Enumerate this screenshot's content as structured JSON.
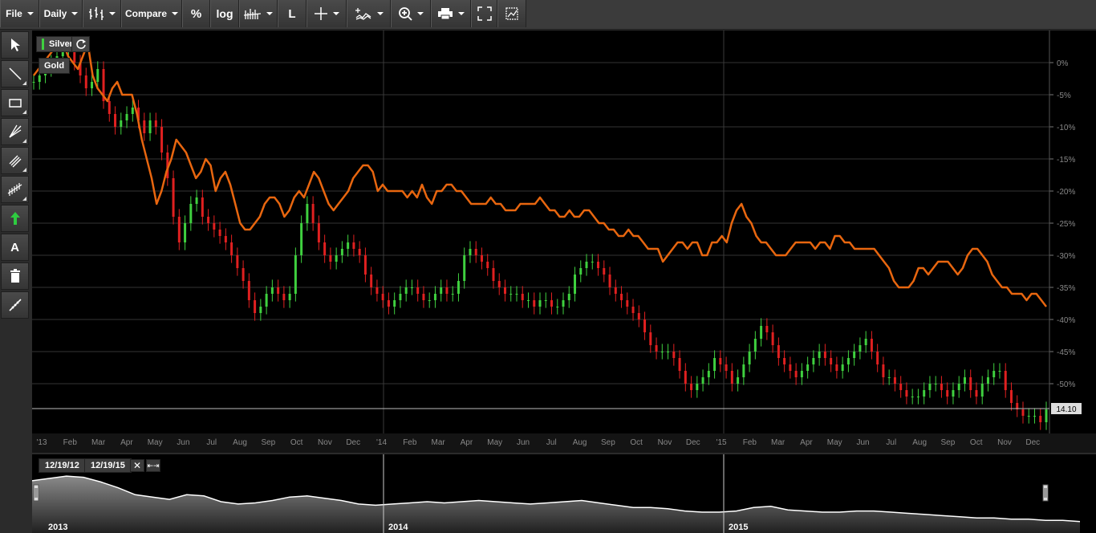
{
  "toolbar": {
    "file": "File",
    "period": "Daily",
    "compare": "Compare",
    "percent": "%",
    "log": "log",
    "line_tool": "L"
  },
  "legend": {
    "series1": "Silver",
    "series2": "Gold"
  },
  "side_tools": [
    {
      "name": "pointer-tool-button",
      "icon": "arrow-cursor-icon"
    },
    {
      "name": "line-tool-button",
      "icon": "diagonal-line-icon"
    },
    {
      "name": "rectangle-tool-button",
      "icon": "rectangle-icon"
    },
    {
      "name": "fan-tool-button",
      "icon": "fan-lines-icon"
    },
    {
      "name": "channel-tool-button",
      "icon": "parallel-lines-icon"
    },
    {
      "name": "pattern-tool-button",
      "icon": "zigzag-pattern-icon"
    },
    {
      "name": "arrow-marker-button",
      "icon": "green-up-arrow-icon"
    },
    {
      "name": "text-tool-button",
      "icon": "text-a-icon",
      "label": "A"
    },
    {
      "name": "delete-drawings-button",
      "icon": "trash-icon"
    },
    {
      "name": "ruler-tool-button",
      "icon": "ruler-icon"
    }
  ],
  "price_label": "14.10",
  "navigator": {
    "start_date": "12/19/12",
    "end_date": "12/19/15",
    "years": [
      "2013",
      "2014",
      "2015"
    ]
  },
  "colors": {
    "silver_up": "#3fd03f",
    "silver_down": "#e02020",
    "gold": "#e8660f",
    "background": "#000000",
    "grid": "#333333",
    "navigator_line": "#ffffff"
  },
  "chart_data": {
    "type": "line",
    "x_ticks": [
      "'13",
      "Feb",
      "Mar",
      "Apr",
      "May",
      "Jun",
      "Jul",
      "Aug",
      "Sep",
      "Oct",
      "Nov",
      "Dec",
      "'14",
      "Feb",
      "Mar",
      "Apr",
      "May",
      "Jun",
      "Jul",
      "Aug",
      "Sep",
      "Oct",
      "Nov",
      "Dec",
      "'15",
      "Feb",
      "Mar",
      "Apr",
      "May",
      "Jun",
      "Jul",
      "Aug",
      "Sep",
      "Oct",
      "Nov",
      "Dec"
    ],
    "y_ticks": [
      "0%",
      "-5%",
      "-10%",
      "-15%",
      "-20%",
      "-25%",
      "-30%",
      "-35%",
      "-40%",
      "-45%",
      "-50%"
    ],
    "ylim": [
      -57,
      4
    ],
    "series": [
      {
        "name": "Gold",
        "style": "line",
        "values": [
          -2,
          -1,
          0,
          1,
          2,
          3,
          3,
          1,
          0,
          -1,
          1,
          3,
          -2,
          -4,
          -5,
          -6,
          -4,
          -3,
          -5,
          -5,
          -5,
          -8,
          -12,
          -15,
          -18,
          -22,
          -20,
          -17,
          -15,
          -12,
          -13,
          -14,
          -16,
          -18,
          -17,
          -15,
          -16,
          -20,
          -18,
          -17,
          -19,
          -22,
          -25,
          -26,
          -26,
          -25,
          -24,
          -22,
          -21,
          -21,
          -22,
          -24,
          -23,
          -21,
          -20,
          -21,
          -19,
          -17,
          -18,
          -20,
          -22,
          -23,
          -22,
          -21,
          -20,
          -18,
          -17,
          -16,
          -16,
          -17,
          -20,
          -19,
          -20,
          -20,
          -20,
          -20,
          -21,
          -20,
          -21,
          -19,
          -21,
          -22,
          -20,
          -20,
          -19,
          -19,
          -20,
          -20,
          -21,
          -22,
          -22,
          -22,
          -22,
          -21,
          -22,
          -22,
          -23,
          -23,
          -23,
          -22,
          -22,
          -22,
          -22,
          -21,
          -22,
          -23,
          -23,
          -24,
          -24,
          -23,
          -24,
          -24,
          -23,
          -23,
          -24,
          -25,
          -25,
          -26,
          -26,
          -27,
          -27,
          -26,
          -27,
          -27,
          -28,
          -29,
          -29,
          -29,
          -31,
          -30,
          -29,
          -28,
          -28,
          -29,
          -28,
          -28,
          -30,
          -30,
          -28,
          -28,
          -27,
          -28,
          -25,
          -23,
          -22,
          -24,
          -25,
          -27,
          -28,
          -28,
          -29,
          -30,
          -30,
          -30,
          -29,
          -28,
          -28,
          -28,
          -28,
          -29,
          -28,
          -28,
          -29,
          -27,
          -27,
          -28,
          -28,
          -29,
          -29,
          -29,
          -29,
          -29,
          -30,
          -31,
          -32,
          -34,
          -35,
          -35,
          -35,
          -34,
          -32,
          -32,
          -33,
          -32,
          -31,
          -31,
          -31,
          -32,
          -33,
          -32,
          -30,
          -29,
          -29,
          -30,
          -31,
          -33,
          -34,
          -35,
          -35,
          -36,
          -36,
          -36,
          -37,
          -36,
          -36,
          -37,
          -38
        ]
      },
      {
        "name": "Silver",
        "style": "candlestick",
        "values": [
          -3,
          -2,
          -1,
          0,
          1,
          2,
          2,
          0,
          -2,
          -4,
          -3,
          -1,
          -6,
          -8,
          -10,
          -9,
          -8,
          -7,
          -9,
          -11,
          -9,
          -10,
          -14,
          -18,
          -24,
          -28,
          -25,
          -22,
          -21,
          -24,
          -25,
          -26,
          -27,
          -28,
          -30,
          -32,
          -34,
          -37,
          -39,
          -38,
          -36,
          -35,
          -36,
          -37,
          -36,
          -30,
          -25,
          -22,
          -25,
          -28,
          -30,
          -31,
          -30,
          -29,
          -28,
          -29,
          -30,
          -33,
          -35,
          -36,
          -37,
          -38,
          -37,
          -36,
          -35,
          -35,
          -36,
          -37,
          -37,
          -36,
          -35,
          -36,
          -36,
          -34,
          -30,
          -29,
          -30,
          -31,
          -32,
          -34,
          -35,
          -36,
          -36,
          -36,
          -37,
          -37,
          -38,
          -37,
          -37,
          -38,
          -38,
          -37,
          -36,
          -33,
          -32,
          -31,
          -31,
          -32,
          -33,
          -35,
          -36,
          -37,
          -38,
          -39,
          -40,
          -42,
          -44,
          -45,
          -45,
          -45,
          -46,
          -48,
          -50,
          -51,
          -50,
          -49,
          -48,
          -46,
          -47,
          -48,
          -50,
          -49,
          -47,
          -45,
          -43,
          -41,
          -42,
          -44,
          -46,
          -47,
          -48,
          -49,
          -48,
          -47,
          -46,
          -45,
          -46,
          -47,
          -48,
          -47,
          -46,
          -45,
          -44,
          -43,
          -45,
          -47,
          -49,
          -49,
          -50,
          -51,
          -52,
          -52,
          -52,
          -51,
          -50,
          -50,
          -51,
          -52,
          -51,
          -50,
          -49,
          -51,
          -52,
          -50,
          -49,
          -48,
          -48,
          -51,
          -53,
          -54,
          -55,
          -55,
          -55,
          -56,
          -54
        ]
      }
    ]
  },
  "navigator_data": [
    -2,
    0,
    2,
    1,
    -3,
    -8,
    -14,
    -16,
    -18,
    -14,
    -15,
    -20,
    -22,
    -21,
    -19,
    -16,
    -15,
    -17,
    -19,
    -22,
    -23,
    -22,
    -21,
    -20,
    -21,
    -20,
    -19,
    -20,
    -21,
    -22,
    -21,
    -20,
    -19,
    -21,
    -23,
    -25,
    -25,
    -26,
    -28,
    -29,
    -29,
    -28,
    -25,
    -24,
    -27,
    -28,
    -29,
    -29,
    -28,
    -28,
    -29,
    -30,
    -31,
    -32,
    -33,
    -34,
    -34,
    -35,
    -35,
    -36,
    -36,
    -37
  ]
}
